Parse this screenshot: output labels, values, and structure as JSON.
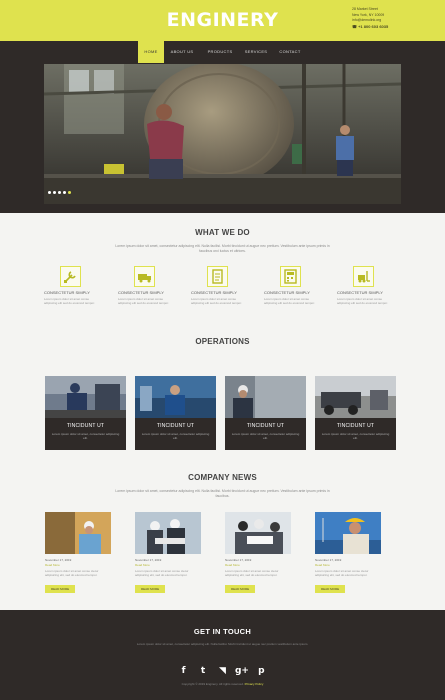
{
  "header": {
    "logo": "ENGINERY",
    "contact_lines": [
      "28 Market Street",
      "New York, NY 10009",
      "info@demolink.org"
    ],
    "phone": "+1 800 603 6035"
  },
  "nav": {
    "items": [
      {
        "label": "HOME",
        "active": true
      },
      {
        "label": "ABOUT US",
        "active": false
      },
      {
        "label": "PRODUCTS",
        "active": false
      },
      {
        "label": "SERVICES",
        "active": false
      },
      {
        "label": "CONTACT",
        "active": false
      }
    ]
  },
  "slider": {
    "dots": 5
  },
  "what_we_do": {
    "title": "WHAT WE DO",
    "subtitle": "Lorem ipsum dolor sit amet, consectetur adipiscing elit. Nulla facilisi. Morbi tincidunt ut augue nec pretium. Vestibulum ante ipsum primis in faucibus orci luctus et ultrices.",
    "features": [
      {
        "icon": "wrench-icon",
        "title": "CONSECTETUR SIMPLY",
        "text": "Lorem ipsum dolor sit amet conse adipiscing elit sed do eiusmod tempor."
      },
      {
        "icon": "truck-icon",
        "title": "CONSECTETUR SIMPLY",
        "text": "Lorem ipsum dolor sit amet conse adipiscing elit sed do eiusmod tempor."
      },
      {
        "icon": "document-icon",
        "title": "CONSECTETUR SIMPLY",
        "text": "Lorem ipsum dolor sit amet conse adipiscing elit sed do eiusmod tempor."
      },
      {
        "icon": "calculator-icon",
        "title": "CONSECTETUR SIMPLY",
        "text": "Lorem ipsum dolor sit amet conse adipiscing elit sed do eiusmod tempor."
      },
      {
        "icon": "forklift-icon",
        "title": "CONSECTETUR SIMPLY",
        "text": "Lorem ipsum dolor sit amet conse adipiscing elit sed do eiusmod tempor."
      }
    ]
  },
  "operations": {
    "title": "OPERATIONS",
    "items": [
      {
        "title": "TINCIDUNT UT",
        "text": "Lorem ipsum dolor sit amet, consectetur adipiscing elit."
      },
      {
        "title": "TINCIDUNT UT",
        "text": "Lorem ipsum dolor sit amet, consectetur adipiscing elit."
      },
      {
        "title": "TINCIDUNT UT",
        "text": "Lorem ipsum dolor sit amet, consectetur adipiscing elit."
      },
      {
        "title": "TINCIDUNT UT",
        "text": "Lorem ipsum dolor sit amet, consectetur adipiscing elit."
      }
    ]
  },
  "news": {
    "title": "COMPANY NEWS",
    "subtitle": "Lorem ipsum dolor sit amet, consectetur adipiscing elit. Nulla facilisi. Morbi tincidunt ut augue nec pretium. Vestibulum ante ipsum primis in faucibus.",
    "items": [
      {
        "date": "November 17, 2019",
        "meta": "Read More",
        "text": "Lorem ipsum dolor sit amet conse ctetur adipisicing elit, sed do eiusmod tempor.",
        "button": "READ MORE"
      },
      {
        "date": "November 17, 2019",
        "meta": "Read More",
        "text": "Lorem ipsum dolor sit amet conse ctetur adipisicing elit, sed do eiusmod tempor.",
        "button": "READ MORE"
      },
      {
        "date": "November 17, 2019",
        "meta": "Read More",
        "text": "Lorem ipsum dolor sit amet conse ctetur adipisicing elit, sed do eiusmod tempor.",
        "button": "READ MORE"
      },
      {
        "date": "November 17, 2019",
        "meta": "Read More",
        "text": "Lorem ipsum dolor sit amet conse ctetur adipisicing elit, sed do eiusmod tempor.",
        "button": "READ MORE"
      }
    ]
  },
  "footer": {
    "title": "GET IN TOUCH",
    "subtitle": "Lorem ipsum dolor sit amet, consectetur adipiscing elit. Nulla facilisi. Morbi tincidunt ut augue nec pretium vestibulum ante ipsum.",
    "socials": [
      {
        "icon": "facebook-icon",
        "glyph": "f"
      },
      {
        "icon": "twitter-icon",
        "glyph": "t"
      },
      {
        "icon": "rss-icon",
        "glyph": "◥"
      },
      {
        "icon": "google-plus-icon",
        "glyph": "g+"
      },
      {
        "icon": "pinterest-icon",
        "glyph": "p"
      }
    ],
    "copyright": "Copyright © 2019 Enginery. All rights reserved.",
    "policy": "Privacy Policy"
  },
  "colors": {
    "accent": "#dfe24e",
    "dark": "#2f2a28",
    "light_bg": "#f4f4f2"
  }
}
